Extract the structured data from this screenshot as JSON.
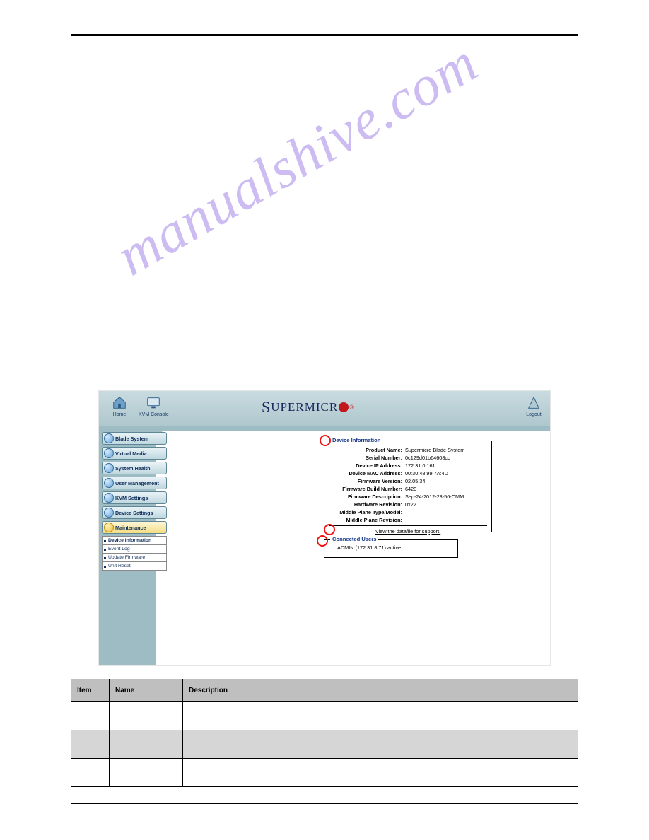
{
  "watermark": "manualshive.com",
  "toolbar": {
    "home": "Home",
    "kvm": "KVM Console",
    "logout": "Logout"
  },
  "logo": {
    "part1": "S",
    "part2": "UPERMICR"
  },
  "nav": {
    "items": [
      "Blade System",
      "Virtual Media",
      "System Health",
      "User Management",
      "KVM Settings",
      "Device Settings",
      "Maintenance"
    ],
    "sub": [
      "Device Information",
      "Event Log",
      "Update Firmware",
      "Unit Reset"
    ]
  },
  "deviceInfo": {
    "legend": "Device Information",
    "rows": [
      {
        "label": "Product Name:",
        "value": "Supermicro Blade System"
      },
      {
        "label": "Serial Number:",
        "value": "0c129d01b64608cc"
      },
      {
        "label": "Device IP Address:",
        "value": "172.31.0.161"
      },
      {
        "label": "Device MAC Address:",
        "value": "00:30:48:99:7A:4D"
      },
      {
        "label": "Firmware Version:",
        "value": "02.05.34"
      },
      {
        "label": "Firmware Build Number:",
        "value": "6420"
      },
      {
        "label": "Firmware Description:",
        "value": "Sep-24-2012-23-56-CMM"
      },
      {
        "label": "Hardware Revision:",
        "value": "0x22"
      },
      {
        "label": "Middle Plane Type/Model:",
        "value": ""
      },
      {
        "label": "Middle Plane Revision:",
        "value": ""
      }
    ],
    "link": "View the datafile for support."
  },
  "connectedUsers": {
    "legend": "Connected Users",
    "line": "ADMIN (172.31.8.71)  active"
  },
  "controlsTable": {
    "headers": [
      "Item",
      "Name",
      "Description"
    ],
    "rows": [
      {
        "item": "",
        "name": "",
        "desc": ""
      },
      {
        "item": "",
        "name": "",
        "desc": ""
      },
      {
        "item": "",
        "name": "",
        "desc": ""
      }
    ]
  }
}
